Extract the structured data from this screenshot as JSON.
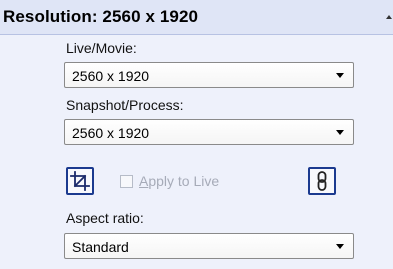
{
  "header": {
    "title": "Resolution: 2560 x 1920"
  },
  "live_movie": {
    "label": "Live/Movie:",
    "value": "2560 x 1920"
  },
  "snapshot_process": {
    "label": "Snapshot/Process:",
    "value": "2560 x 1920"
  },
  "crop": {
    "icon": "crop-icon"
  },
  "apply_to_live": {
    "label_first": "A",
    "label_rest": "pply to Live",
    "checked": false,
    "enabled": false
  },
  "link": {
    "icon": "link-icon"
  },
  "aspect_ratio": {
    "label": "Aspect ratio:",
    "value": "Standard"
  },
  "colors": {
    "header_bg": "#dfe5f6",
    "panel_bg": "#eef1fb",
    "button_border": "#1b3a8f",
    "disabled_text": "#a6abb8"
  }
}
